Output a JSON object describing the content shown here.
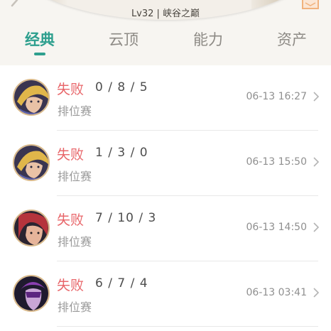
{
  "header": {
    "level_region": "Lv32 | 峡谷之巅"
  },
  "tabs": [
    {
      "label": "经典",
      "active": true
    },
    {
      "label": "云顶",
      "active": false
    },
    {
      "label": "能力",
      "active": false
    },
    {
      "label": "资产",
      "active": false
    }
  ],
  "matches": [
    {
      "result": "失败",
      "kda": "0 / 8 / 5",
      "mode": "排位赛",
      "time": "06-13 16:27",
      "avatar_icon": "champion-ezreal-avatar-icon"
    },
    {
      "result": "失败",
      "kda": "1 / 3 / 0",
      "mode": "排位赛",
      "time": "06-13 15:50",
      "avatar_icon": "champion-ezreal-avatar-icon"
    },
    {
      "result": "失败",
      "kda": "7 / 10 / 3",
      "mode": "排位赛",
      "time": "06-13 14:50",
      "avatar_icon": "champion-red-hair-avatar-icon"
    },
    {
      "result": "失败",
      "kda": "6 / 7 / 4",
      "mode": "排位赛",
      "time": "06-13 03:41",
      "avatar_icon": "champion-purple-mask-avatar-icon"
    }
  ],
  "colors": {
    "accent": "#2e9f8e",
    "loss": "#e8666a"
  }
}
